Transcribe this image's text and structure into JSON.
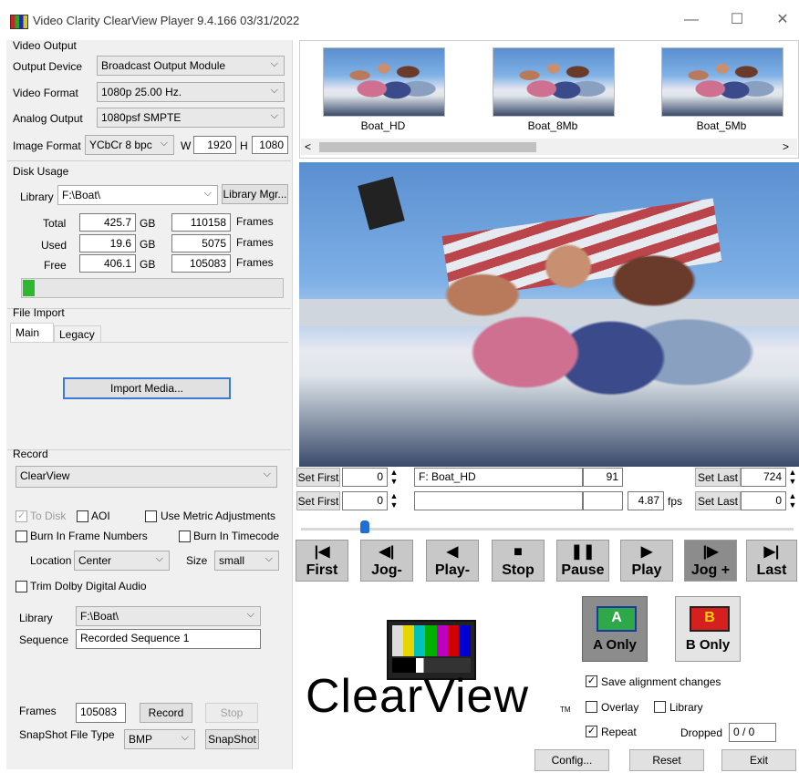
{
  "window": {
    "title": "Video Clarity ClearView Player  9.4.166  03/31/2022",
    "minimize": "—",
    "maximize": "☐",
    "close": "✕"
  },
  "video_output": {
    "group_label": "Video Output",
    "output_device_label": "Output Device",
    "output_device_value": "Broadcast Output Module",
    "video_format_label": "Video Format",
    "video_format_value": "1080p 25.00 Hz.",
    "analog_output_label": "Analog Output",
    "analog_output_value": "1080psf SMPTE",
    "image_format_label": "Image Format",
    "image_format_value": "YCbCr 8 bpc",
    "w_label": "W",
    "w_value": "1920",
    "h_label": "H",
    "h_value": "1080"
  },
  "disk_usage": {
    "group_label": "Disk Usage",
    "library_label": "Library",
    "library_value": "F:\\Boat\\",
    "library_mgr_button": "Library Mgr...",
    "rows": [
      {
        "label": "Total",
        "gb": "425.7",
        "gb_unit": "GB",
        "frames": "110158",
        "frames_unit": "Frames"
      },
      {
        "label": "Used",
        "gb": "19.6",
        "gb_unit": "GB",
        "frames": "5075",
        "frames_unit": "Frames"
      },
      {
        "label": "Free",
        "gb": "406.1",
        "gb_unit": "GB",
        "frames": "105083",
        "frames_unit": "Frames"
      }
    ],
    "usage_fraction": 0.046
  },
  "file_import": {
    "group_label": "File Import",
    "tabs": [
      "Main",
      "Legacy"
    ],
    "import_button": "Import Media..."
  },
  "record": {
    "group_label": "Record",
    "device_value": "ClearView",
    "to_disk_label": "To Disk",
    "to_disk_checked": true,
    "aoi_label": "AOI",
    "metric_label": "Use Metric Adjustments",
    "burn_frame_label": "Burn In Frame Numbers",
    "burn_timecode_label": "Burn In Timecode",
    "location_label": "Location",
    "location_value": "Center",
    "size_label": "Size",
    "size_value": "small",
    "trim_dolby_label": "Trim Dolby Digital Audio",
    "library_label": "Library",
    "library_value": "F:\\Boat\\",
    "sequence_label": "Sequence",
    "sequence_value": "Recorded Sequence 1",
    "frames_label": "Frames",
    "frames_value": "105083",
    "record_button": "Record",
    "stop_button": "Stop",
    "snapshot_type_label": "SnapShot File Type",
    "snapshot_type_value": "BMP",
    "snapshot_button": "SnapShot"
  },
  "thumbnails": [
    {
      "label": "Boat_HD"
    },
    {
      "label": "Boat_8Mb"
    },
    {
      "label": "Boat_5Mb"
    }
  ],
  "scroll": {
    "left": "<",
    "right": ">"
  },
  "timeline": {
    "row1": {
      "set_first": "Set First",
      "first_value": "0",
      "file": "F: Boat_HD",
      "frame": "91",
      "set_last": "Set Last",
      "last_value": "724"
    },
    "row2": {
      "set_first": "Set First",
      "first_value": "0",
      "fps_value": "4.87",
      "fps_label": "fps",
      "set_last": "Set Last",
      "last_value": "0"
    },
    "playhead_fraction": 0.13
  },
  "transport": [
    {
      "glyph": "|◀",
      "label": "First"
    },
    {
      "glyph": "◀|",
      "label": "Jog-"
    },
    {
      "glyph": "◀",
      "label": "Play-"
    },
    {
      "glyph": "■",
      "label": "Stop"
    },
    {
      "glyph": "❚❚",
      "label": "Pause"
    },
    {
      "glyph": "▶",
      "label": "Play"
    },
    {
      "glyph": "|▶",
      "label": "Jog +"
    },
    {
      "glyph": "▶|",
      "label": "Last"
    }
  ],
  "ab": {
    "a_letter": "A",
    "a_label": "A Only",
    "b_letter": "B",
    "b_label": "B Only"
  },
  "logo": {
    "text": "ClearView",
    "tm": "TM"
  },
  "options": {
    "save_alignment_label": "Save alignment changes",
    "save_alignment_checked": true,
    "overlay_label": "Overlay",
    "library_label": "Library",
    "repeat_label": "Repeat",
    "repeat_checked": true,
    "dropped_label": "Dropped",
    "dropped_value": "0 / 0"
  },
  "footer": {
    "config": "Config...",
    "reset": "Reset",
    "exit": "Exit"
  },
  "colors": {
    "accent_green": "#2fb82f",
    "a_green": "#2fa84a",
    "b_red": "#d61f1f",
    "active_button": "#8c8c8c"
  }
}
